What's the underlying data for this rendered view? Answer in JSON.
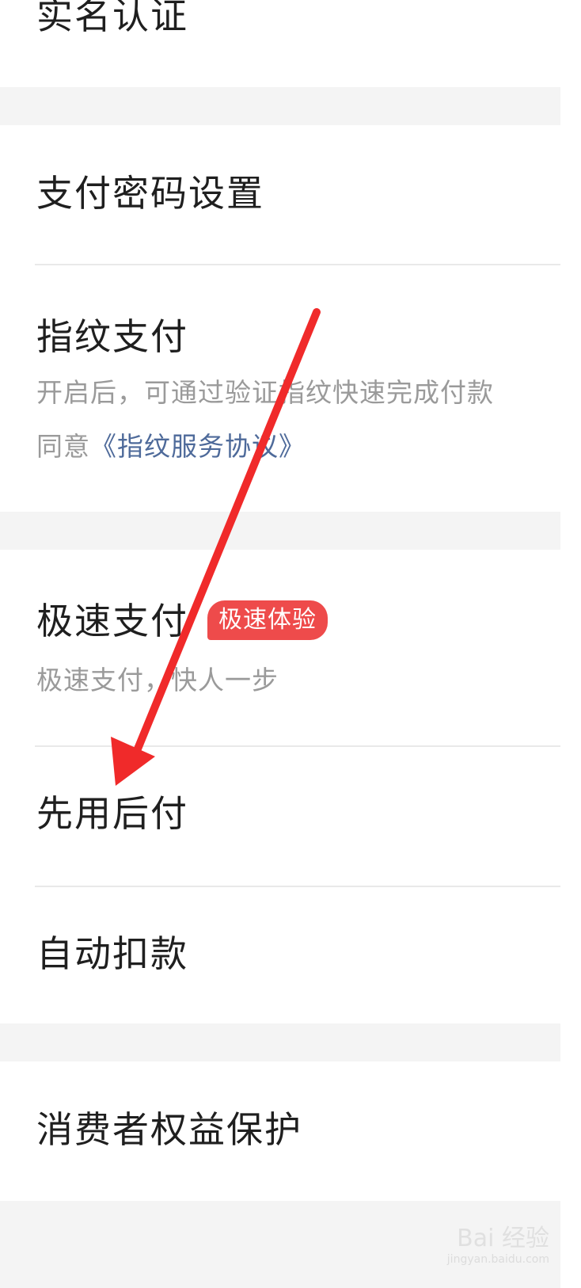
{
  "settings": {
    "real_name": "实名认证",
    "payment_password": "支付密码设置",
    "fingerprint": {
      "title": "指纹支付",
      "description": "开启后，可通过验证指纹快速完成付款",
      "agree_prefix": "同意",
      "agreement_link": "《指纹服务协议》"
    },
    "express_pay": {
      "title": "极速支付",
      "badge": "极速体验",
      "description": "极速支付，快人一步"
    },
    "pay_later": "先用后付",
    "auto_debit": "自动扣款",
    "consumer_protection": "消费者权益保护"
  },
  "watermark": {
    "brand": "Bai 经验",
    "url": "jingyan.baidu.com"
  },
  "colors": {
    "background": "#f4f4f4",
    "card": "#ffffff",
    "title_text": "#1f1f1f",
    "sub_text": "#9a9a9a",
    "link_text": "#4e6a9a",
    "badge_bg": "#ee4b4b",
    "annotation_arrow": "#f02a2a"
  }
}
